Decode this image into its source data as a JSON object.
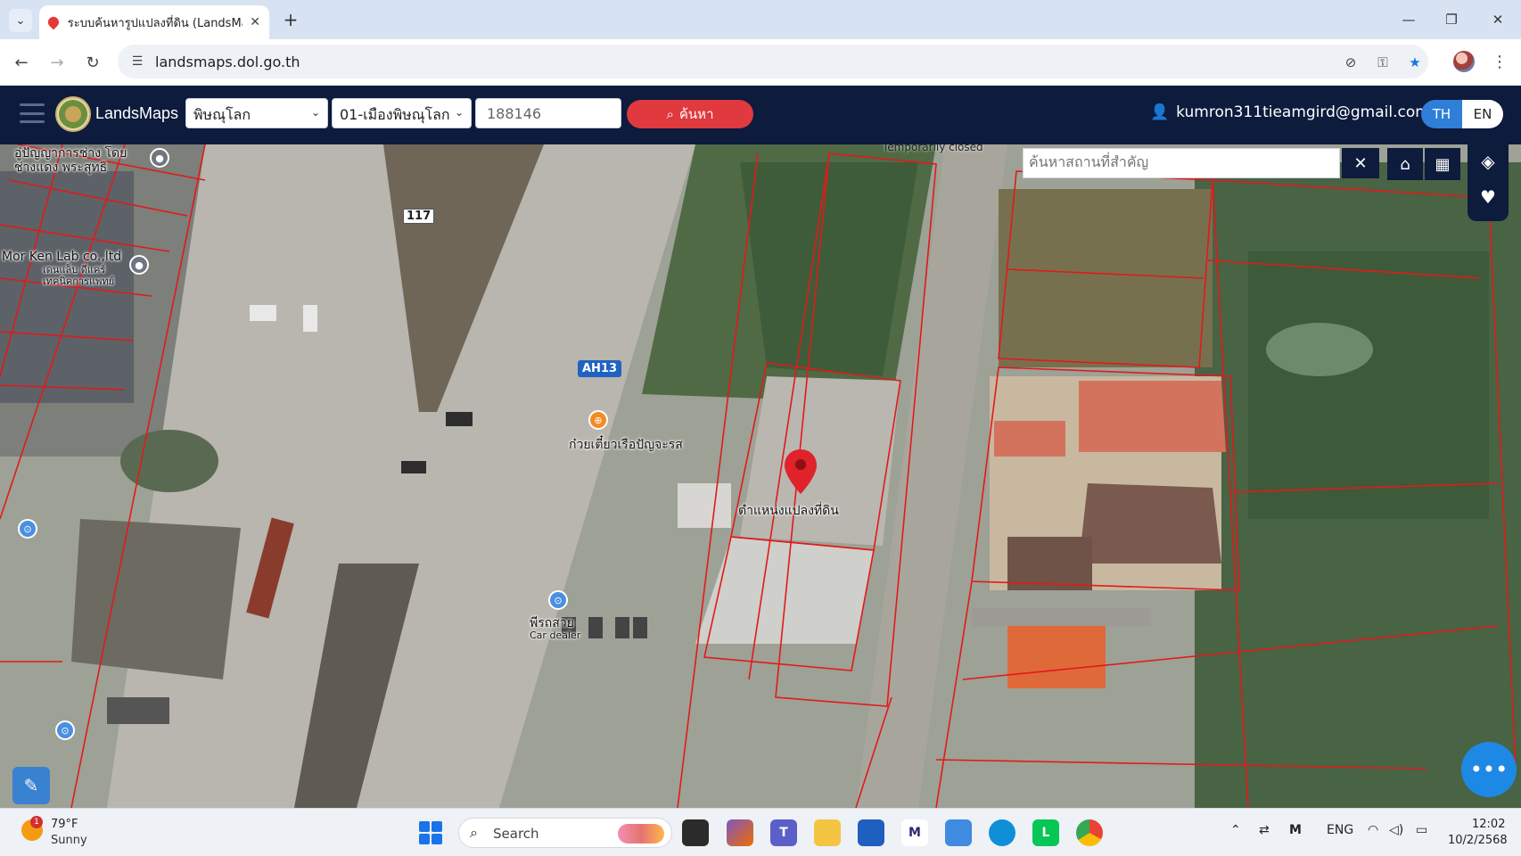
{
  "browser": {
    "tab_title": "ระบบค้นหารูปแปลงที่ดิน (LandsMaps)",
    "tab_close": "✕",
    "new_tab": "+",
    "url": "landsmaps.dol.go.th",
    "window_minimize": "—",
    "window_restore": "❐",
    "window_close": "✕"
  },
  "app": {
    "brand": "LandsMaps",
    "province": "พิษณุโลก",
    "district": "01-เมืองพิษณุโลก",
    "parcel_number": "188146",
    "search_label": "ค้นหา",
    "user_email": "kumron311tieamgird@gmail.com",
    "lang_th": "TH",
    "lang_en": "EN"
  },
  "map": {
    "place_search_placeholder": "ค้นหาสถานที่สำคัญ",
    "clear_label": "✕",
    "temporarily_closed": "Temporarily closed",
    "labels": {
      "shop_top_left": "อู่ปัญญาการช่าง โดยช่างแดง พระสุทธิ",
      "mor_ken_lab": "Mor Ken Lab co.,ltd",
      "mor_ken_lab_th": "เดนแล็บ ดีแคร์ เทคนิคการแพทย์",
      "route_117": "117",
      "ah13": "AH13",
      "noodle_shop": "ก๋วยเตี๋ยวเรือปัญจะรส",
      "parcel_position": "ตำแหน่งแปลงที่ดิน",
      "car_dealer_th": "พีรถสวย",
      "car_dealer_en": "Car dealer"
    }
  },
  "taskbar": {
    "temperature": "79°F",
    "condition": "Sunny",
    "weather_badge": "1",
    "search_label": "Search",
    "language": "ENG",
    "time": "12:02",
    "date": "10/2/2568"
  }
}
